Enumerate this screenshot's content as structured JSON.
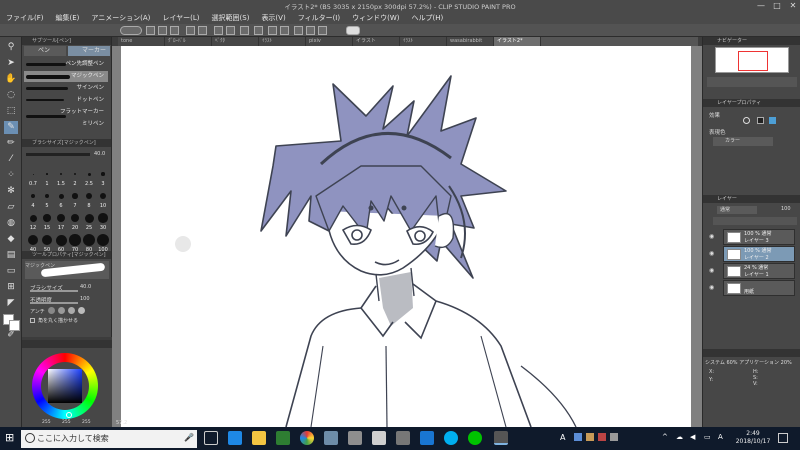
{
  "window": {
    "title": "イラスト2* (B5 3035 x 2150px 300dpi 57.2%) - CLIP STUDIO PAINT PRO",
    "min_label": "—",
    "max_label": "□",
    "close_label": "✕"
  },
  "menu": [
    "ファイル(F)",
    "編集(E)",
    "アニメーション(A)",
    "レイヤー(L)",
    "選択範囲(S)",
    "表示(V)",
    "フィルター(I)",
    "ウィンドウ(W)",
    "ヘルプ(H)"
  ],
  "tabs": [
    "tone",
    "ｸﾞﾛｰﾊﾞﾙ",
    "ﾍﾞｸﾀ",
    "ｲﾗｽﾄ",
    "pixiv",
    "イラスト",
    "ｲﾗｽﾄ",
    "wasabirabbit",
    "イラスト2*"
  ],
  "subtool": {
    "panel_title": "サブツール[ペン]",
    "tab_pen": "ペン",
    "tab_marker": "マーカー",
    "items": [
      "ペン先調整ペン",
      "マジックペン",
      "サインペン",
      "ドットペン",
      "フラットマーカー",
      "ミリペン"
    ],
    "selected_index": 1
  },
  "brush_size": {
    "panel_title": "ブラシサイズ[マジックペン]",
    "value": "40.0",
    "labels": [
      "0.7",
      "1",
      "1.5",
      "2",
      "2.5",
      "3",
      "4",
      "5",
      "6",
      "7",
      "8",
      "10",
      "12",
      "15",
      "17",
      "20",
      "25",
      "30",
      "40",
      "50",
      "60",
      "70",
      "80",
      "100"
    ]
  },
  "tool_property": {
    "panel_title": "ツールプロパティ[マジックペン]",
    "preview_label": "マジックペン",
    "brush_size_label": "ブラシサイズ",
    "brush_size_value": "40.0",
    "opacity_label": "不透明度",
    "opacity_value": "100",
    "aa_label": "アンチ",
    "stabilize_label": "角を丸く描かせる"
  },
  "color": {
    "values": [
      "255",
      "255",
      "255"
    ]
  },
  "canvas": {
    "zoom_text": "57.2"
  },
  "right": {
    "navigator_title": "ナビゲーター",
    "layer_property_title": "レイヤープロパティ",
    "effect_label": "効果",
    "expression_color_label": "表現色",
    "color_mode_value": "カラー",
    "layer_title": "レイヤー",
    "blend_mode": "通常",
    "opacity": "100",
    "layers": [
      {
        "name": "100 % 通常",
        "sub": "レイヤー 3",
        "selected": false
      },
      {
        "name": "100 % 通常",
        "sub": "レイヤー 2",
        "selected": true
      },
      {
        "name": "24 % 通常",
        "sub": "レイヤー 1",
        "selected": false
      },
      {
        "name": "",
        "sub": "用紙",
        "selected": false
      }
    ],
    "status_title": "システム 60%  アプリケーション 20%",
    "status_values": [
      "X:",
      "Y:",
      "H:",
      "S:",
      "V:"
    ]
  },
  "taskbar": {
    "search_placeholder": "ここに入力して検索",
    "time": "2:49",
    "date": "2018/10/17",
    "ime_label": "A",
    "ime_mode": "A"
  },
  "colors": {
    "hair": "#8f93c0",
    "line": "#3e4352",
    "taskbar": "#0f1a2b"
  }
}
